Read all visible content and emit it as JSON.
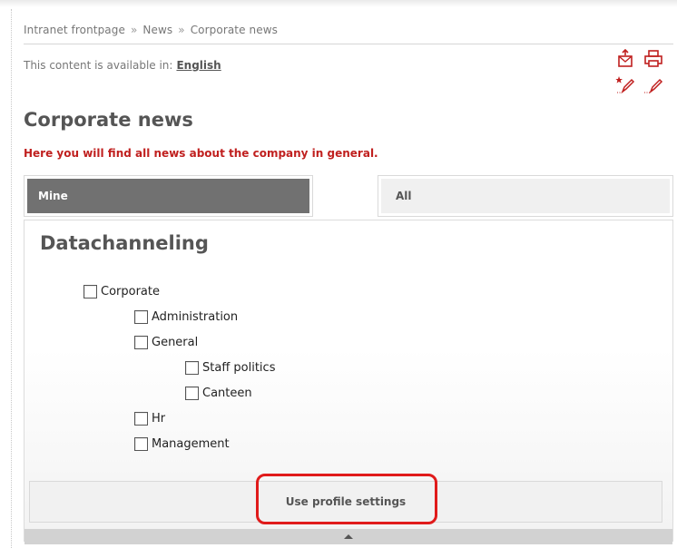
{
  "breadcrumb": {
    "items": [
      "Intranet frontpage",
      "News",
      "Corporate news"
    ],
    "separator": "»"
  },
  "language": {
    "label": "This content is available in:",
    "current": "English"
  },
  "toolbar": {
    "icons": [
      "email-page-icon",
      "print-icon",
      "subscribe-edit-icon",
      "edit-icon"
    ],
    "accent": "#c0201f"
  },
  "page": {
    "title": "Corporate news",
    "subtitle": "Here you will find all news about the company in general."
  },
  "tabs": [
    {
      "label": "Mine",
      "active": true
    },
    {
      "label": "All",
      "active": false
    }
  ],
  "datachanneling": {
    "heading": "Datachanneling",
    "items": [
      {
        "label": "Corporate",
        "level": 0,
        "checked": false
      },
      {
        "label": "Administration",
        "level": 1,
        "checked": false
      },
      {
        "label": "General",
        "level": 1,
        "checked": false
      },
      {
        "label": "Staff politics",
        "level": 2,
        "checked": false
      },
      {
        "label": "Canteen",
        "level": 2,
        "checked": false
      },
      {
        "label": "Hr",
        "level": 1,
        "checked": false
      },
      {
        "label": "Management",
        "level": 1,
        "checked": false
      }
    ]
  },
  "profile_button": {
    "label": "Use profile settings"
  },
  "highlight_color": "#e01b1b"
}
